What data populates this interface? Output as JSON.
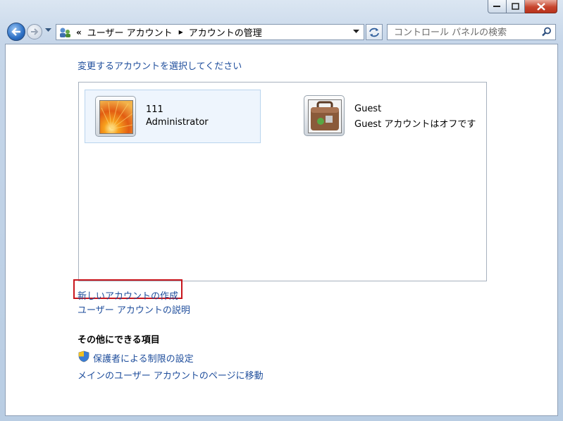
{
  "window": {
    "minimize_label": "minimize",
    "maximize_label": "maximize",
    "close_label": "close"
  },
  "nav": {
    "address_chevron": "«",
    "breadcrumbs": [
      "ユーザー アカウント",
      "アカウントの管理"
    ],
    "search_placeholder": "コントロール パネルの検索"
  },
  "content": {
    "heading": "変更するアカウントを選択してください",
    "accounts": [
      {
        "name": "111",
        "type": "Administrator",
        "selected": true,
        "picture": "flower"
      },
      {
        "name": "Guest",
        "type": "Guest アカウントはオフです",
        "selected": false,
        "picture": "suitcase"
      }
    ],
    "create_account_link": "新しいアカウントの作成",
    "explain_link": "ユーザー アカウントの説明",
    "other_heading": "その他にできる項目",
    "parental_controls_link": "保護者による制限の設定",
    "main_accounts_link": "メインのユーザー アカウントのページに移動"
  },
  "colors": {
    "link": "#1f4e9c",
    "highlight_box": "#c8161d",
    "selected_tile_bg": "#eef5fd"
  },
  "icons": [
    "back-arrow-icon",
    "forward-arrow-icon",
    "control-panel-icon",
    "refresh-icon",
    "search-icon",
    "shield-icon"
  ]
}
